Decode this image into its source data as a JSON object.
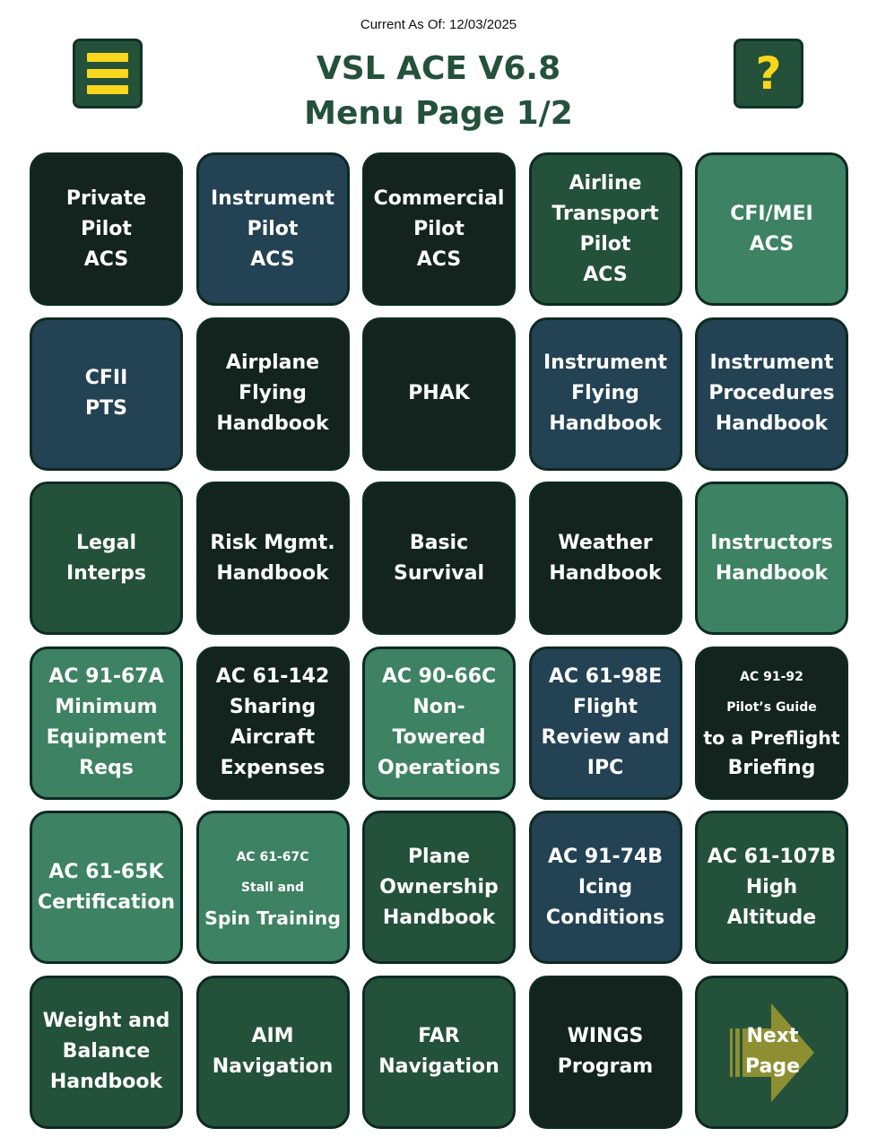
{
  "header": {
    "date": "Current As Of: 12/03/2025",
    "title_line1": "VSL ACE V6.8",
    "title_line2": "Menu Page 1/2",
    "help_glyph": "?"
  },
  "colors": {
    "dark": "#13241e",
    "navy": "#234253",
    "green": "#24513a",
    "light": "#3d8262",
    "accent": "#f9d71c",
    "arrow": "#8d8f32"
  },
  "tiles": [
    {
      "lines": [
        "Private",
        "Pilot",
        "ACS"
      ]
    },
    {
      "lines": [
        "Instrument",
        "Pilot",
        "ACS"
      ]
    },
    {
      "lines": [
        "Commercial",
        "Pilot",
        "ACS"
      ]
    },
    {
      "lines": [
        "Airline",
        "Transport",
        "Pilot",
        "ACS"
      ]
    },
    {
      "lines": [
        "CFI/MEI",
        "ACS"
      ]
    },
    {
      "lines": [
        "CFII",
        "PTS"
      ]
    },
    {
      "lines": [
        "Airplane",
        "Flying",
        "Handbook"
      ]
    },
    {
      "lines": [
        "PHAK"
      ]
    },
    {
      "lines": [
        "Instrument",
        "Flying",
        "Handbook"
      ]
    },
    {
      "lines": [
        "Instrument",
        "Procedures",
        "Handbook"
      ]
    },
    {
      "lines": [
        "Legal",
        "Interps"
      ]
    },
    {
      "lines": [
        "Risk Mgmt.",
        "Handbook"
      ]
    },
    {
      "lines": [
        "Basic",
        "Survival"
      ]
    },
    {
      "lines": [
        "Weather",
        "Handbook"
      ]
    },
    {
      "lines": [
        "Instructors",
        "Handbook"
      ]
    },
    {
      "lines": [
        "AC 91-67A",
        "Minimum",
        "Equipment",
        "Reqs"
      ]
    },
    {
      "lines": [
        "AC 61-142",
        "Sharing",
        "Aircraft",
        "Expenses"
      ]
    },
    {
      "lines": [
        "AC 90-66C",
        "Non-",
        "Towered",
        "Operations"
      ]
    },
    {
      "lines": [
        "AC 61-98E",
        "Flight",
        "Review and",
        "IPC"
      ]
    },
    {
      "lines": [
        "AC 91-92",
        "Pilot’s Guide",
        "to a Preflight",
        "Briefing"
      ]
    },
    {
      "lines": [
        "AC 61-65K",
        "Certification"
      ]
    },
    {
      "lines": [
        "AC 61-67C",
        "Stall and",
        "Spin Training"
      ]
    },
    {
      "lines": [
        "Plane",
        "Ownership",
        "Handbook"
      ]
    },
    {
      "lines": [
        "AC 91-74B",
        "Icing",
        "Conditions"
      ]
    },
    {
      "lines": [
        "AC 61-107B",
        "High",
        "Altitude"
      ]
    },
    {
      "lines": [
        "Weight and",
        "Balance",
        "Handbook"
      ]
    },
    {
      "lines": [
        "AIM",
        "Navigation"
      ]
    },
    {
      "lines": [
        "FAR",
        "Navigation"
      ]
    },
    {
      "lines": [
        "WINGS",
        "Program"
      ]
    },
    {
      "lines": [
        "Next",
        "Page"
      ]
    }
  ]
}
